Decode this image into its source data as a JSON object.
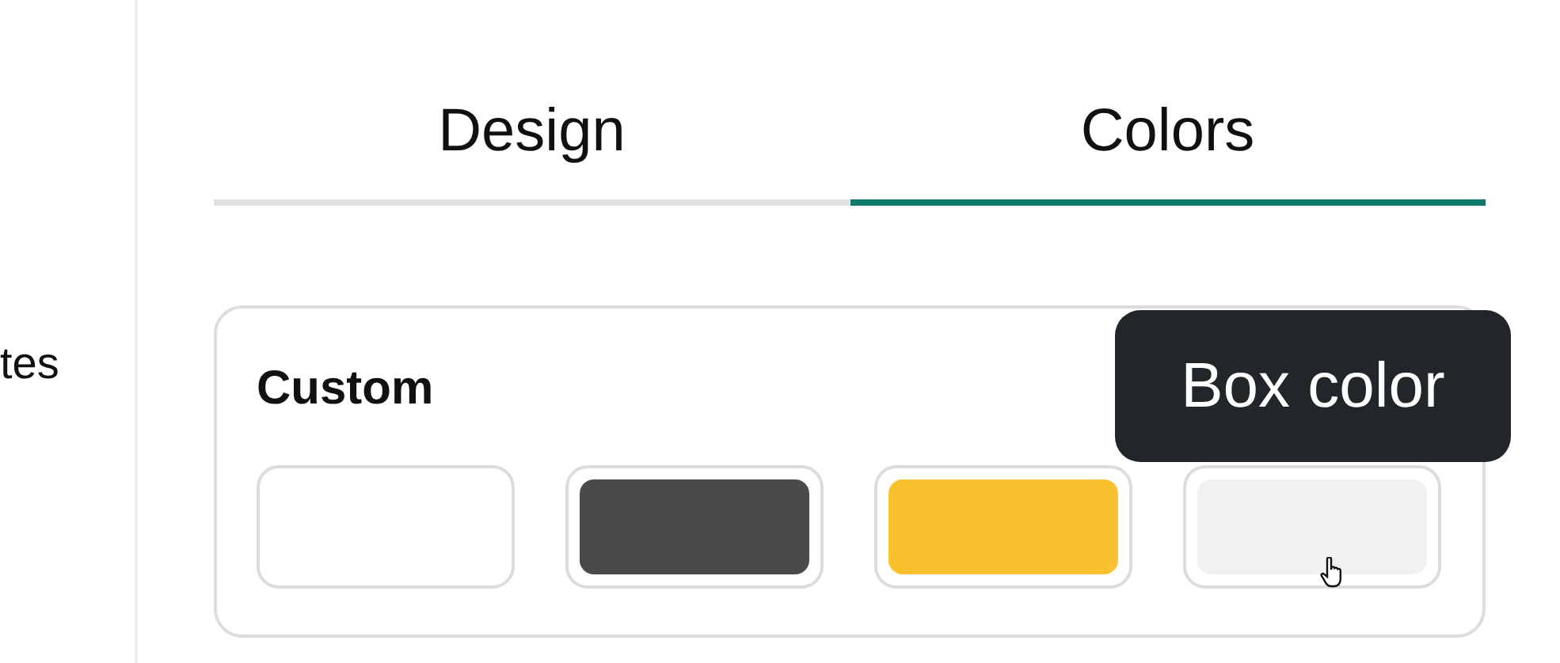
{
  "sidebar": {
    "items": [
      {
        "label": "tes"
      }
    ]
  },
  "tabs": [
    {
      "label": "Design",
      "selected": false
    },
    {
      "label": "Colors",
      "selected": true
    }
  ],
  "panel": {
    "title": "Custom",
    "swatches": [
      {
        "color": "#ffffff"
      },
      {
        "color": "#4a4a4a"
      },
      {
        "color": "#fbc02d"
      },
      {
        "color": "#f1f1f1"
      }
    ],
    "tooltip": {
      "text": "Box color"
    }
  }
}
